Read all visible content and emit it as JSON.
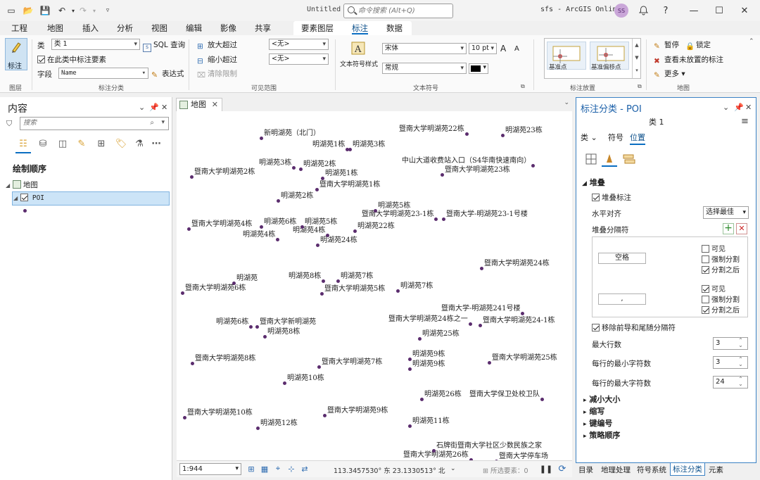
{
  "titlebar": {
    "doc_title": "Untitled",
    "search_placeholder": "命令搜索 (Alt+Q)",
    "user": "sfs - ArcGIS Online",
    "avatar_initials": "SS",
    "minimize": "—",
    "maximize": "☐",
    "close": "✕",
    "bell": "🔔",
    "help": "?"
  },
  "ribbon_tabs": [
    "工程",
    "地图",
    "插入",
    "分析",
    "视图",
    "编辑",
    "影像",
    "共享"
  ],
  "context_tabs": {
    "layer": "要素图层",
    "label": "标注",
    "data": "数据"
  },
  "ribbon": {
    "layer_group": {
      "button": "标注",
      "label": "图层"
    },
    "class_group": {
      "class_label": "类",
      "class_value": "类 1",
      "sql_button": "SQL 查询",
      "label_in_class": "在此类中标注要素",
      "field_label": "字段",
      "field_value": "Name",
      "expression_button": "表达式",
      "label": "标注分类"
    },
    "visibility_group": {
      "zoom_in_beyond": "放大超过",
      "zoom_out_beyond": "缩小超过",
      "clear_limits": "清除限制",
      "zoom_in_value": "<无>",
      "zoom_out_value": "<无>",
      "label": "可见范围"
    },
    "symbol_group": {
      "text_symbol_style": "文本符号样式",
      "font": "宋体",
      "size": "10 pt",
      "style": "常规",
      "grow": "A",
      "shrink": "A",
      "label": "文本符号"
    },
    "placement_group": {
      "tile1": "基准点",
      "tile2": "基准偏移点",
      "label": "标注放置"
    },
    "map_group": {
      "pause": "暂停",
      "lock": "锁定",
      "view_unplaced": "查看未放置的标注",
      "more": "更多",
      "label": "地图"
    }
  },
  "contents": {
    "title": "内容",
    "search_placeholder": "搜索",
    "drawing_order": "绘制顺序",
    "map_item": "地图",
    "layer_item": "POI"
  },
  "map_tab": {
    "label": "地图"
  },
  "map_labels": [
    {
      "text": "新明湖苑（北门）",
      "dot": "left"
    },
    {
      "text": "暨南大学明湖苑22栋",
      "dot": "right"
    },
    {
      "text": "明湖苑23栋",
      "dot": "left"
    },
    {
      "text": "明湖苑1栋",
      "dot": "right"
    },
    {
      "text": "明湖苑3栋",
      "dot": "left"
    },
    {
      "text": "明湖苑3栋",
      "dot": "right"
    },
    {
      "text": "明湖苑2栋",
      "dot": "left"
    },
    {
      "text": "中山大道收费站入口（S4华南快速南向）",
      "dot": "right"
    },
    {
      "text": "暨南大学明湖苑2栋",
      "dot": "left"
    },
    {
      "text": "明湖苑1栋",
      "dot": "left"
    },
    {
      "text": "暨南大学明湖苑23栋",
      "dot": "left"
    },
    {
      "text": "暨南大学明湖苑1栋",
      "dot": "left"
    },
    {
      "text": "明湖苑2栋",
      "dot": "left"
    },
    {
      "text": "明湖苑5栋",
      "dot": "left"
    },
    {
      "text": "暨南大学明湖苑23-1栋",
      "dot": "right"
    },
    {
      "text": "暨南大学-明湖苑23-1号楼",
      "dot": "left"
    },
    {
      "text": "暨南大学明湖苑4栋",
      "dot": "left"
    },
    {
      "text": "明湖苑6栋",
      "dot": "left"
    },
    {
      "text": "明湖苑5栋",
      "dot": "left"
    },
    {
      "text": "明湖苑22栋",
      "dot": "left"
    },
    {
      "text": "明湖苑4栋",
      "dot": "right"
    },
    {
      "text": "明湖苑4栋",
      "dot": "right"
    },
    {
      "text": "明湖苑24栋",
      "dot": "left"
    },
    {
      "text": "暨南大学明湖苑24栋",
      "dot": "left"
    },
    {
      "text": "明湖苑",
      "dot": "left"
    },
    {
      "text": "明湖苑8栋",
      "dot": "right"
    },
    {
      "text": "明湖苑7栋",
      "dot": "left"
    },
    {
      "text": "暨南大学明湖苑6栋",
      "dot": "left"
    },
    {
      "text": "暨南大学明湖苑5栋",
      "dot": "left"
    },
    {
      "text": "明湖苑7栋",
      "dot": "left"
    },
    {
      "text": "暨南大学-明湖苑241号楼",
      "dot": "right"
    },
    {
      "text": "暨南大学明湖苑24栋之一",
      "dot": "right"
    },
    {
      "text": "暨南大学明湖苑24-1栋",
      "dot": "left"
    },
    {
      "text": "明湖苑6栋",
      "dot": "right"
    },
    {
      "text": "暨南大学新明湖苑",
      "dot": "left"
    },
    {
      "text": "明湖苑8栋",
      "dot": "left"
    },
    {
      "text": "明湖苑25栋",
      "dot": "left"
    },
    {
      "text": "明湖苑9栋",
      "dot": "left"
    },
    {
      "text": "暨南大学明湖苑8栋",
      "dot": "left"
    },
    {
      "text": "暨南大学明湖苑7栋",
      "dot": "left"
    },
    {
      "text": "明湖苑9栋",
      "dot": "left"
    },
    {
      "text": "暨南大学明湖苑25栋",
      "dot": "left"
    },
    {
      "text": "明湖苑10栋",
      "dot": "left"
    },
    {
      "text": "明湖苑26栋",
      "dot": "left"
    },
    {
      "text": "暨南大学保卫处校卫队",
      "dot": "right"
    },
    {
      "text": "暨南大学明湖苑10栋",
      "dot": "left"
    },
    {
      "text": "暨南大学明湖苑9栋",
      "dot": "left"
    },
    {
      "text": "明湖苑12栋",
      "dot": "left"
    },
    {
      "text": "明湖苑11栋",
      "dot": "left"
    },
    {
      "text": "石牌街暨南大学社区少数民族之家",
      "dot": "left"
    },
    {
      "text": "暨南大学明湖苑26栋",
      "dot": "right"
    },
    {
      "text": "暨南大学停车场",
      "dot": "left"
    }
  ],
  "status": {
    "scale": "1:944",
    "coords": "113.3457530° 东  23.1330513° 北",
    "selected": "所选要素：0"
  },
  "label_class_pane": {
    "title": "标注分类 - POI",
    "class_name": "类 1",
    "tabs": {
      "class": "类",
      "symbol": "符号",
      "position": "位置"
    },
    "stacking_section": "堆叠",
    "stack_labels": "堆叠标注",
    "horizontal_align": "水平对齐",
    "horizontal_align_value": "选择最佳",
    "stack_separator": "堆叠分隔符",
    "separators": [
      {
        "value": "空格",
        "visible": "可见",
        "force": "强制分割",
        "after": "分割之后"
      },
      {
        "value": ",",
        "visible": "可见",
        "force": "强制分割",
        "after": "分割之后"
      }
    ],
    "remove_separators": "移除前导和尾随分隔符",
    "max_lines": "最大行数",
    "max_lines_value": "3",
    "min_chars": "每行的最小字符数",
    "min_chars_value": "3",
    "max_chars": "每行的最大字符数",
    "max_chars_value": "24",
    "sections": [
      "减小大小",
      "缩写",
      "键编号",
      "策略顺序"
    ]
  },
  "bottom_tabs": [
    "目录",
    "地理处理",
    "符号系统",
    "标注分类",
    "元素"
  ]
}
